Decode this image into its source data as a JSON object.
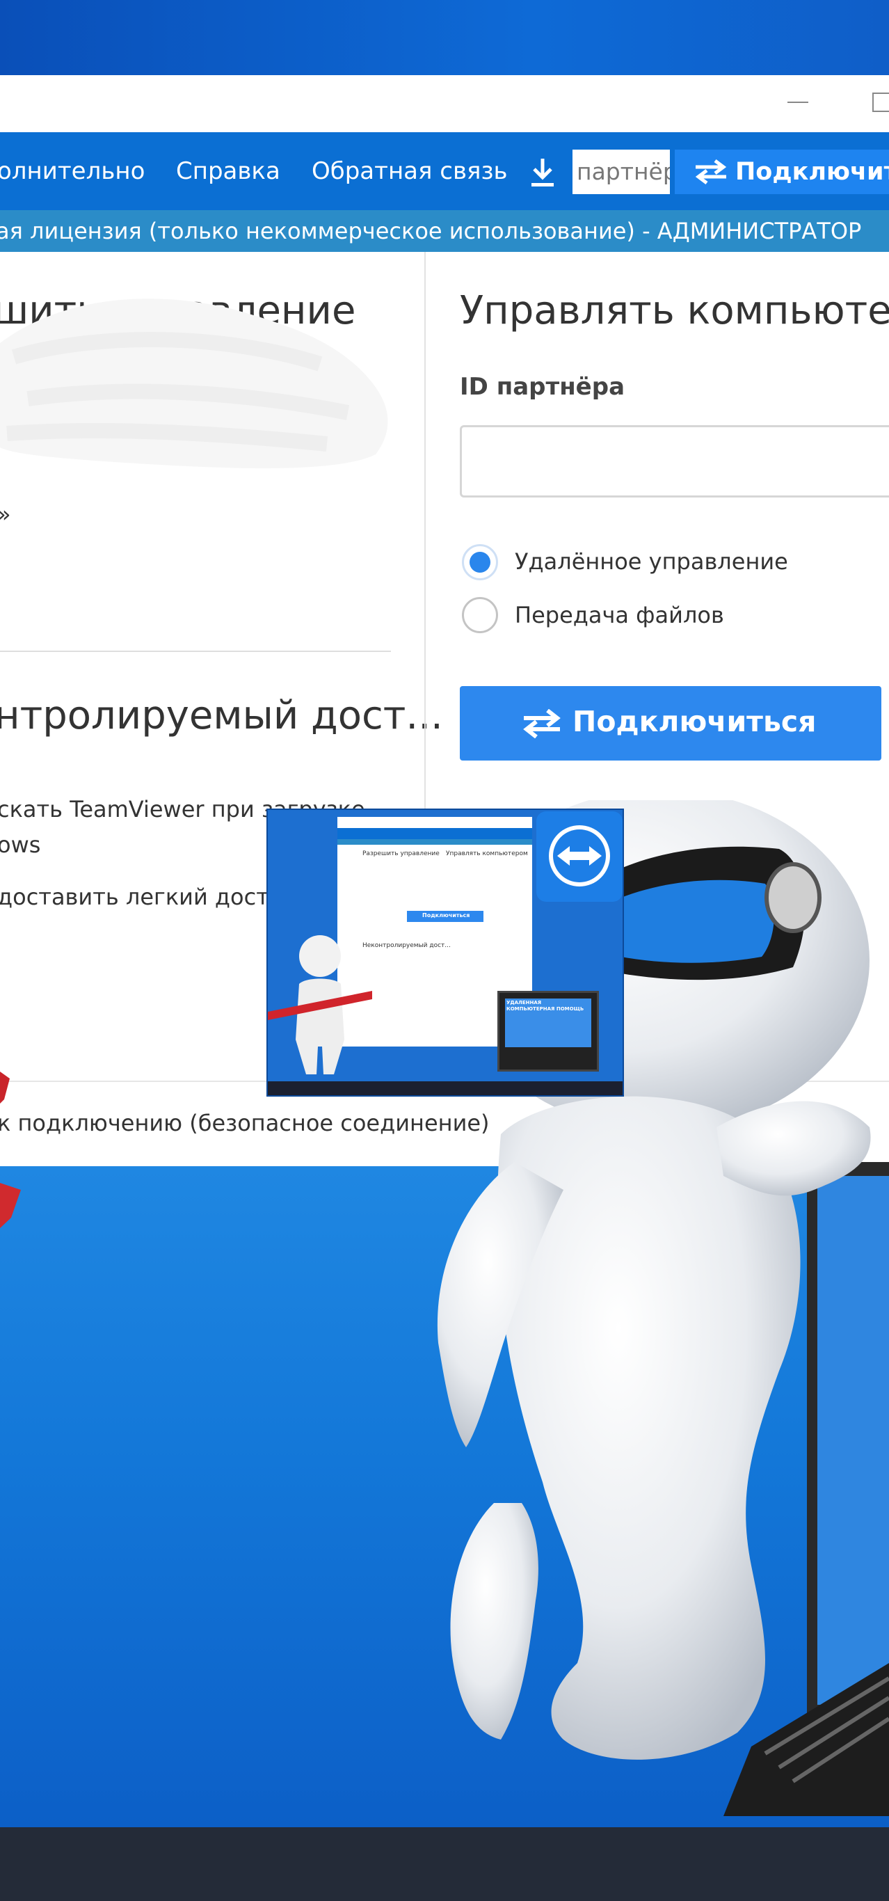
{
  "window": {
    "menu": {
      "items": [
        "олнительно",
        "Справка",
        "Обратная связь"
      ],
      "partner_placeholder": "партнёр",
      "connect_label": "Подключить"
    },
    "license_text": "ая лицензия (только некоммерческое использование) - АДМИНИСТРАТОР",
    "left": {
      "allow_title": "шить управление",
      "pwd_hint": "»",
      "unattended_title": "нтролируемый дост...",
      "option1_line1": "скать TeamViewer при загрузке",
      "option1_line2": "ows",
      "option2": "доставить легкий доступ"
    },
    "right": {
      "title": "Управлять компьютеро",
      "partner_id_label": "ID партнёра",
      "partner_id_value": "",
      "radio_remote": "Удалённое управление",
      "radio_file": "Передача файлов",
      "selected_mode": "Удалённое управление",
      "connect_button": "Подключиться"
    },
    "status_text": "к подключению (безопасное соединение)"
  },
  "thumbnail": {
    "mini_title": "Разрешить управление",
    "mini_title_right": "Управлять компьютером",
    "mini_connect": "Подключиться",
    "mini_unattended": "Неконтролируемый дост...",
    "banner_text": "УДАЛЕННАЯ КОМПЬЮТЕРНАЯ ПОМОЩЬ"
  },
  "colors": {
    "menubar": "#0b6fd3",
    "license_bar": "#2b8cc8",
    "accent_button": "#2d88ee",
    "taskbar": "#242b38"
  },
  "icons": {
    "download": "download-icon",
    "connect_arrows": "swap-arrows-icon",
    "minimize": "minimize-icon",
    "maximize": "maximize-icon"
  }
}
